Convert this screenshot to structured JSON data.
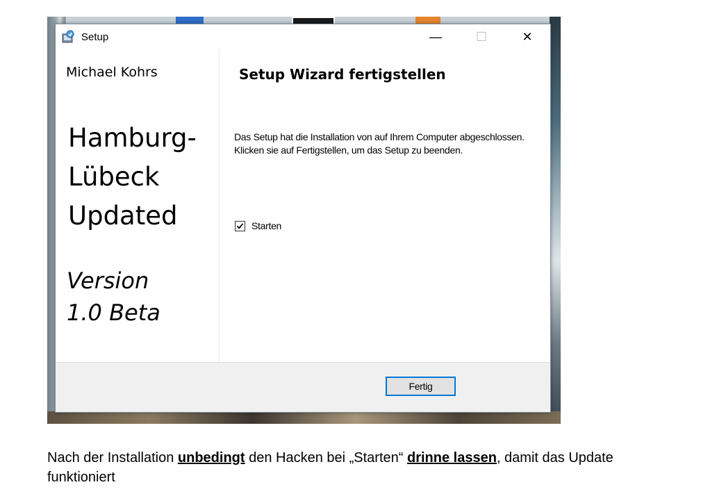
{
  "window": {
    "title": "Setup",
    "minimize_glyph": "—",
    "maximize_glyph": "☐",
    "close_glyph": "✕"
  },
  "left_panel": {
    "author": "Michael Kohrs",
    "product_lines": [
      "Hamburg-",
      "Lübeck",
      "Updated"
    ],
    "version_lines": [
      "Version",
      "1.0 Beta"
    ]
  },
  "wizard": {
    "title": "Setup Wizard fertigstellen",
    "text": "Das Setup hat die Installation von  auf Ihrem Computer abgeschlossen. Klicken sie auf Fertigstellen, um das Setup zu beenden.",
    "checkbox_label": "Starten",
    "checkbox_checked": true,
    "finish_button": "Fertig"
  },
  "caption": {
    "part1": "Nach der Installation ",
    "emphasis1": "unbedingt",
    "part2": " den Hacken bei „Starten“ ",
    "emphasis2": "drinne  lassen",
    "part3": ", damit das Update funktioniert"
  },
  "colors": {
    "accent_border": "#0078d7",
    "dialog_bg": "#f0f0f0"
  },
  "icons": {
    "app": "setup-installer-icon",
    "checkbox": "checkmark-icon"
  }
}
